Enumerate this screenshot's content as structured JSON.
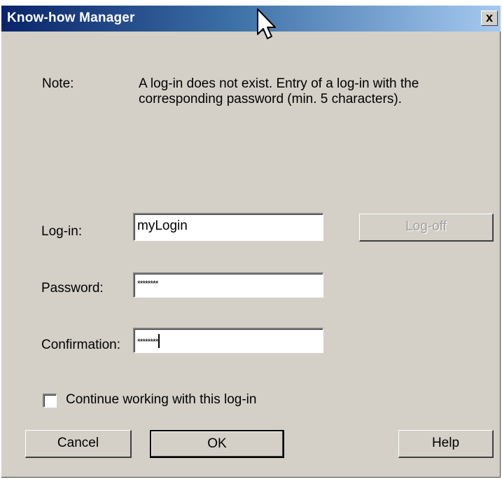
{
  "window": {
    "title": "Know-how Manager",
    "close_label": "x"
  },
  "note": {
    "label": "Note:",
    "text": "A log-in does not exist. Entry of a log-in with the corresponding password (min. 5 characters)."
  },
  "form": {
    "login_label": "Log-in:",
    "login_value": "myLogin",
    "password_label": "Password:",
    "password_value": "********",
    "confirmation_label": "Confirmation:",
    "confirmation_value": "********",
    "logoff_label": "Log-off",
    "continue_label": "Continue working with this log-in",
    "continue_checked": false
  },
  "buttons": {
    "cancel": "Cancel",
    "ok": "OK",
    "help": "Help"
  },
  "colors": {
    "dialog_bg": "#d4d0c8",
    "titlebar_start": "#0a246a",
    "titlebar_end": "#a6caf0"
  }
}
